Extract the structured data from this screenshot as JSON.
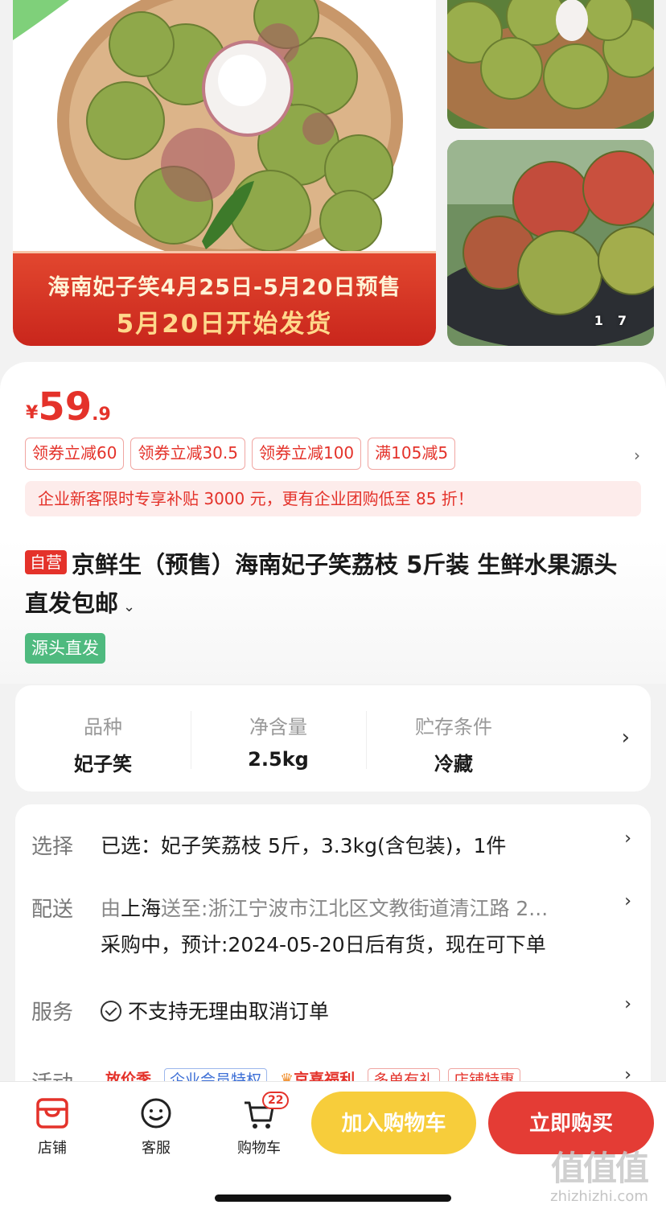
{
  "gallery": {
    "banner_line1": "海南妃子笑4月25日-5月20日预售",
    "banner_line2": "5月20日开始发货",
    "counter_current": "1",
    "counter_total": "7"
  },
  "price": {
    "symbol": "¥",
    "integer": "59",
    "decimal": ".9"
  },
  "coupons": [
    "领券立减60",
    "领券立减30.5",
    "领券立减100",
    "满105减5"
  ],
  "subsidy_text": "企业新客限时专享补贴 3000 元，更有企业团购低至 85 折！",
  "product": {
    "self_badge": "自营",
    "title": "京鲜生（预售）海南妃子笑荔枝 5斤装 生鲜水果源头直发包邮",
    "source_badge": "源头直发"
  },
  "attributes": [
    {
      "key": "品种",
      "value": "妃子笑"
    },
    {
      "key": "净含量",
      "value": "2.5kg"
    },
    {
      "key": "贮存条件",
      "value": "冷藏"
    }
  ],
  "details": {
    "select_label": "选择",
    "select_value": "已选：妃子笑荔枝 5斤，3.3kg(含包装)，1件",
    "delivery_label": "配送",
    "delivery_from": "由",
    "delivery_city": "上海",
    "delivery_to": "送至:浙江宁波市江北区文教街道清江路 2...",
    "delivery_status": "采购中，预计:2024-05-20日后有货，现在可下单",
    "service_label": "服务",
    "service_value": "不支持无理由取消订单",
    "activity_label": "活动",
    "activity_tags": [
      "放价季",
      "企业会员特权",
      "京喜福利",
      "多单有礼",
      "店铺特惠"
    ]
  },
  "bottom_bar": {
    "store_label": "店铺",
    "service_label": "客服",
    "cart_label": "购物车",
    "cart_count": "22",
    "add_to_cart": "加入购物车",
    "buy_now": "立即购买"
  },
  "watermark": {
    "mark": "值值值",
    "site": "zhizhizhi.com"
  },
  "colors": {
    "accent_red": "#e4322a",
    "cart_yellow": "#f7cd3b",
    "source_green": "#4fba7f"
  }
}
